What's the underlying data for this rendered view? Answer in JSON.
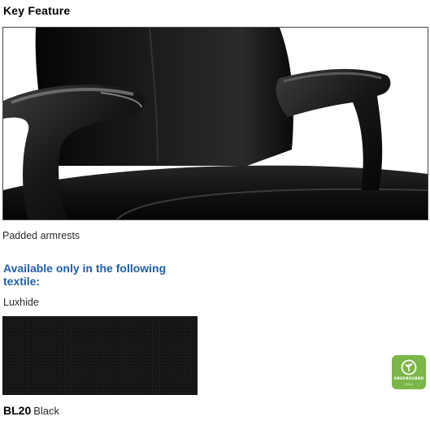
{
  "key_feature": {
    "heading": "Key Feature",
    "caption": "Padded armrests"
  },
  "textile": {
    "heading": "Available only in the following textile:",
    "name": "Luxhide",
    "swatch": {
      "code": "BL20",
      "color_name": "Black",
      "color": "#121416"
    }
  },
  "certification": {
    "icon": "greenguard-logo",
    "title": "GREENGUARD",
    "subtitle": "GOLD",
    "color": "#7ab648"
  },
  "colors": {
    "heading_accent": "#1f5fa8"
  }
}
